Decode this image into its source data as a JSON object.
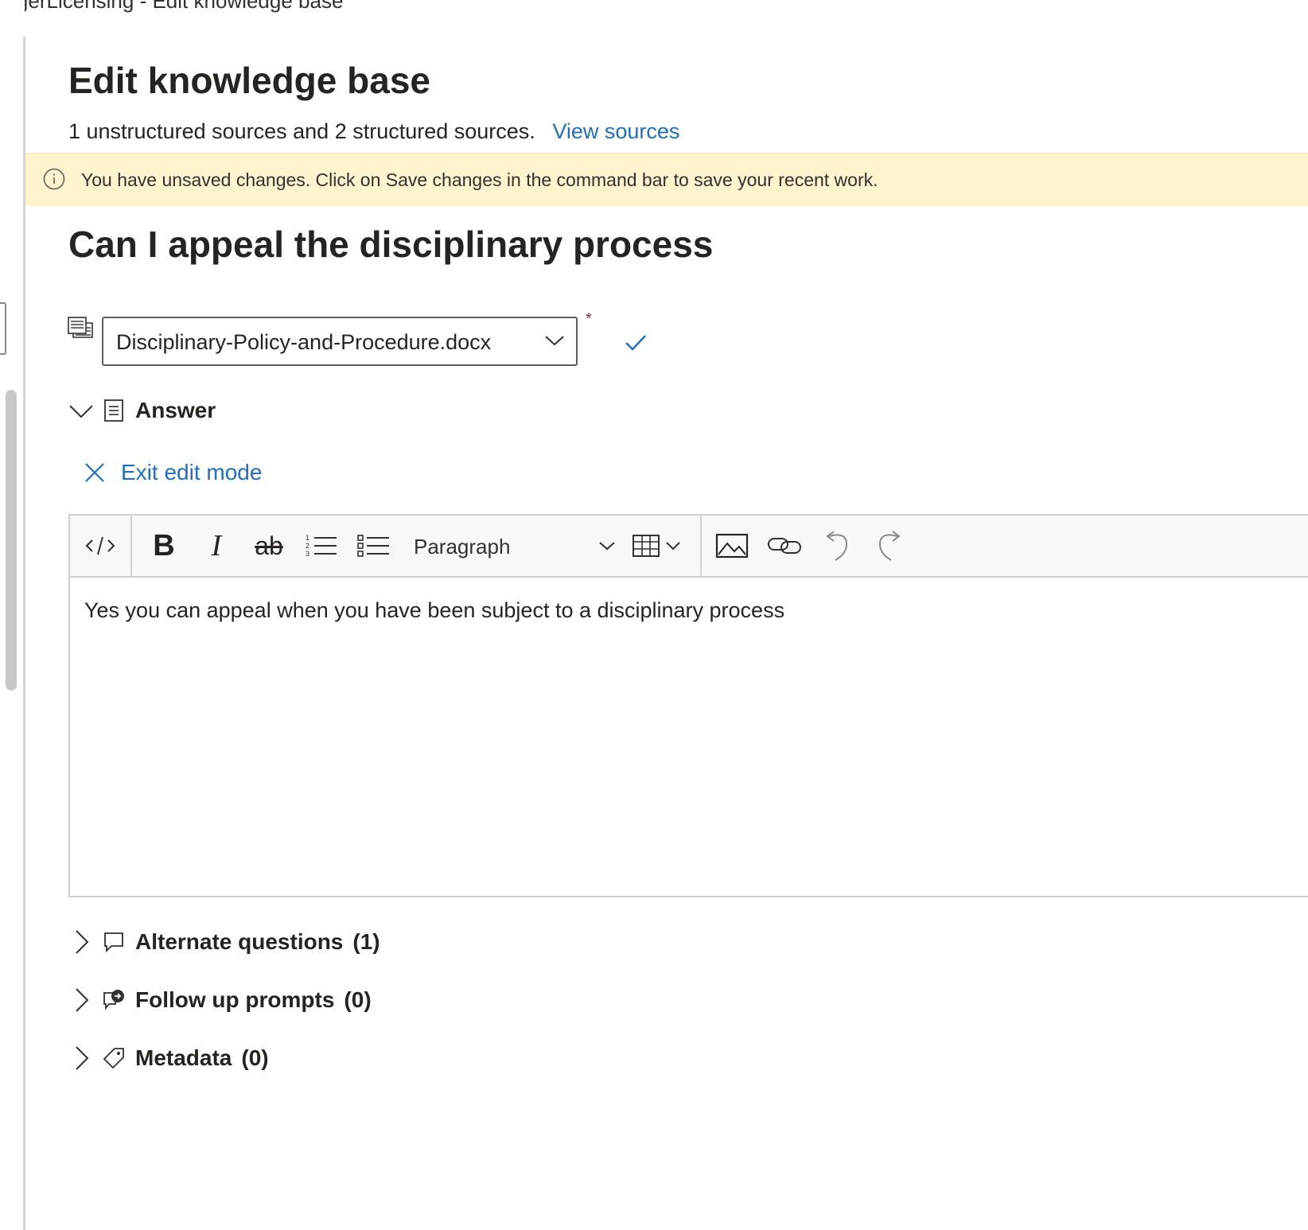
{
  "window": {
    "title": "adgerLicensing - Edit knowledge base"
  },
  "page": {
    "title": "Edit knowledge base",
    "sources_summary": "1 unstructured sources and 2 structured sources.",
    "view_sources_link": "View sources"
  },
  "banner": {
    "icon": "info-icon",
    "message": "You have unsaved changes. Click on Save changes in the command bar to save your recent work."
  },
  "qna": {
    "question": "Can I appeal the disciplinary process",
    "source": {
      "selected": "Disciplinary-Policy-and-Procedure.docx",
      "required_mark": "*"
    },
    "answer_section": {
      "label": "Answer",
      "expanded": true
    },
    "exit_edit_label": "Exit edit mode",
    "editor": {
      "toolbar": {
        "format_select": "Paragraph",
        "buttons": [
          "code-view",
          "bold",
          "italic",
          "strikethrough",
          "numbered-list",
          "bulleted-list",
          "paragraph-format",
          "table",
          "image",
          "link",
          "undo",
          "redo"
        ]
      },
      "content": "Yes you can appeal when you have been subject to a disciplinary process"
    },
    "sections": [
      {
        "label": "Alternate questions",
        "count": "(1)",
        "icon": "chat-bubble-icon"
      },
      {
        "label": "Follow up prompts",
        "count": "(0)",
        "icon": "follow-up-prompt-icon"
      },
      {
        "label": "Metadata",
        "count": "(0)",
        "icon": "tag-icon"
      }
    ]
  },
  "colors": {
    "link": "#1e6fc4",
    "banner_bg": "#fff4ce",
    "required": "#a4262c",
    "text": "#252423"
  }
}
